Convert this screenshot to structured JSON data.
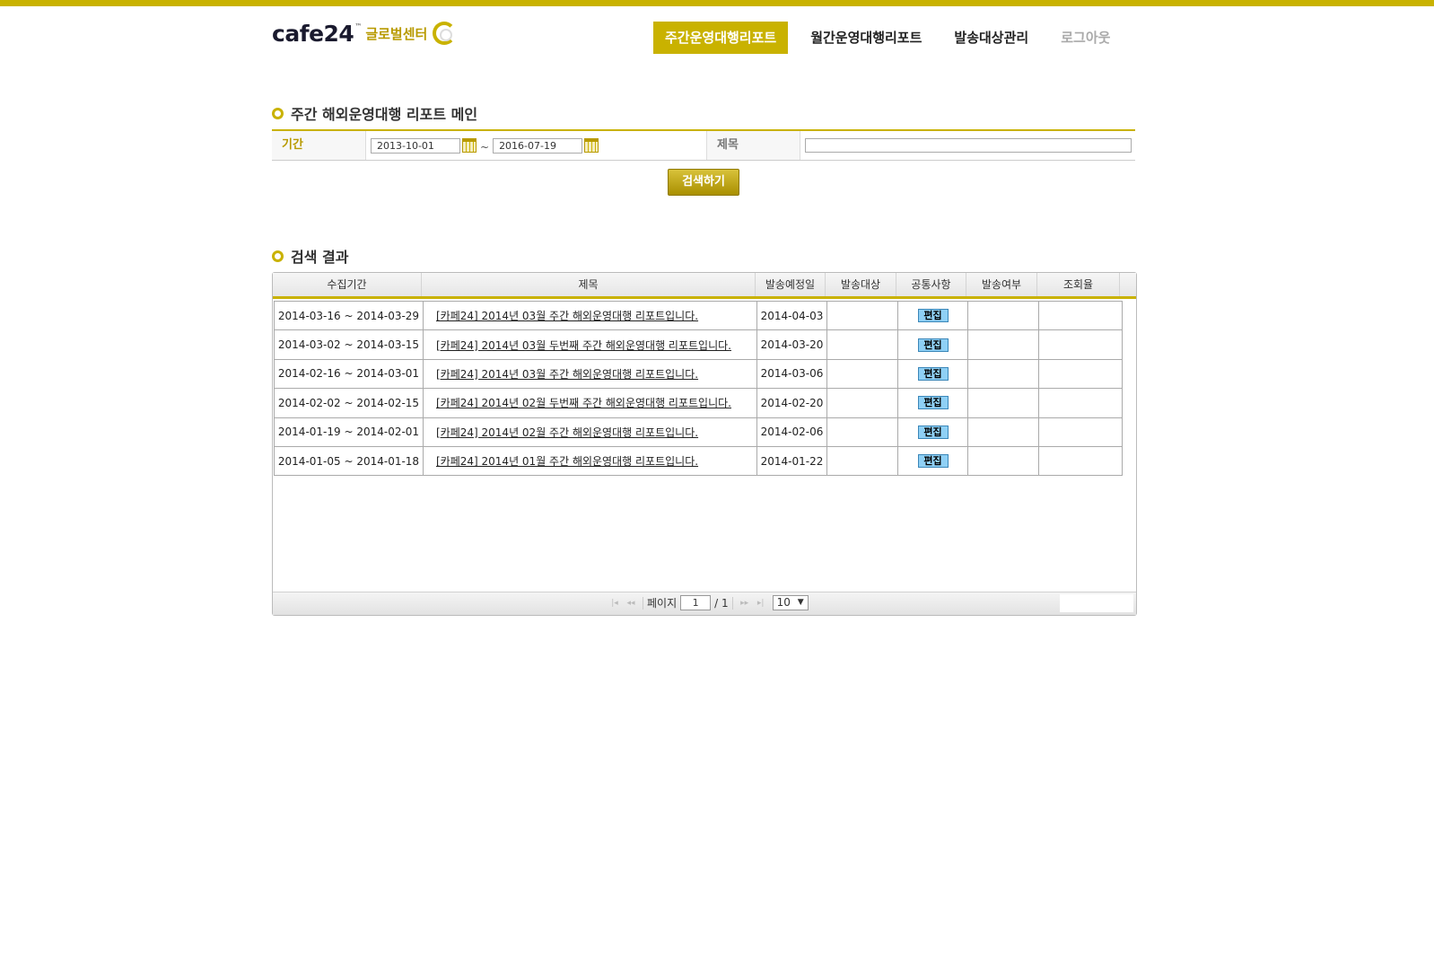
{
  "header": {
    "logo_text": "cafe24",
    "logo_tm": "™",
    "logo_sub": "글로벌센터",
    "nav": [
      {
        "label": "주간운영대행리포트",
        "active": true
      },
      {
        "label": "월간운영대행리포트",
        "active": false
      },
      {
        "label": "발송대상관리",
        "active": false
      },
      {
        "label": "로그아웃",
        "active": false
      }
    ]
  },
  "main": {
    "section_title": "주간 해외운영대행 리포트 메인",
    "form": {
      "period_label": "기간",
      "start_date": "2013-10-01",
      "tilde": "~",
      "end_date": "2016-07-19",
      "title_label": "제목",
      "title_value": ""
    },
    "search_button": "검색하기",
    "results_title": "검색 결과",
    "columns": [
      "수집기간",
      "제목",
      "발송예정일",
      "발송대상",
      "공통사항",
      "발송여부",
      "조회율"
    ],
    "rows": [
      {
        "period": "2014-03-16 ~ 2014-03-29",
        "title": "[카페24] 2014년 03월 주간 해외운영대행 리포트입니다.",
        "send_date": "2014-04-03",
        "target": "",
        "common": "편집",
        "sent": "",
        "rate": ""
      },
      {
        "period": "2014-03-02 ~ 2014-03-15",
        "title": "[카페24] 2014년 03월 두번째 주간 해외운영대행 리포트입니다.",
        "send_date": "2014-03-20",
        "target": "",
        "common": "편집",
        "sent": "",
        "rate": ""
      },
      {
        "period": "2014-02-16 ~ 2014-03-01",
        "title": "[카페24] 2014년 03월 주간 해외운영대행 리포트입니다.",
        "send_date": "2014-03-06",
        "target": "",
        "common": "편집",
        "sent": "",
        "rate": ""
      },
      {
        "period": "2014-02-02 ~ 2014-02-15",
        "title": "[카페24] 2014년 02월 두번째 주간 해외운영대행 리포트입니다.",
        "send_date": "2014-02-20",
        "target": "",
        "common": "편집",
        "sent": "",
        "rate": ""
      },
      {
        "period": "2014-01-19 ~ 2014-02-01",
        "title": "[카페24] 2014년 02월 주간 해외운영대행 리포트입니다.",
        "send_date": "2014-02-06",
        "target": "",
        "common": "편집",
        "sent": "",
        "rate": ""
      },
      {
        "period": "2014-01-05 ~ 2014-01-18",
        "title": "[카페24] 2014년 01월 주간 해외운영대행 리포트입니다.",
        "send_date": "2014-01-22",
        "target": "",
        "common": "편집",
        "sent": "",
        "rate": ""
      }
    ],
    "pager": {
      "page_label": "페이지",
      "current_page": "1",
      "total": "/ 1",
      "page_size": "10"
    }
  },
  "colors": {
    "accent": "#c9b200",
    "edit_badge": "#8fd0f5"
  }
}
